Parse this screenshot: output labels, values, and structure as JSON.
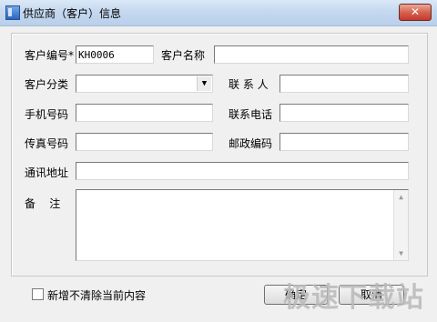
{
  "window": {
    "title": "供应商（客户）信息",
    "close_label": "✕"
  },
  "form": {
    "customer_id_label": "客户编号*",
    "customer_id_value": "KH0006",
    "customer_name_label": "客户名称",
    "customer_name_value": "",
    "category_label": "客户分类",
    "category_value": "",
    "contact_label": "联 系 人",
    "contact_value": "",
    "mobile_label": "手机号码",
    "mobile_value": "",
    "phone_label": "联系电话",
    "phone_value": "",
    "fax_label": "传真号码",
    "fax_value": "",
    "postcode_label": "邮政编码",
    "postcode_value": "",
    "address_label": "通讯地址",
    "address_value": "",
    "notes_label": "备    注",
    "notes_value": ""
  },
  "footer": {
    "keep_content_label": "新增不清除当前内容",
    "keep_content_checked": false,
    "ok_label": "确定",
    "cancel_label": "取消"
  },
  "watermark": "极速下载站"
}
